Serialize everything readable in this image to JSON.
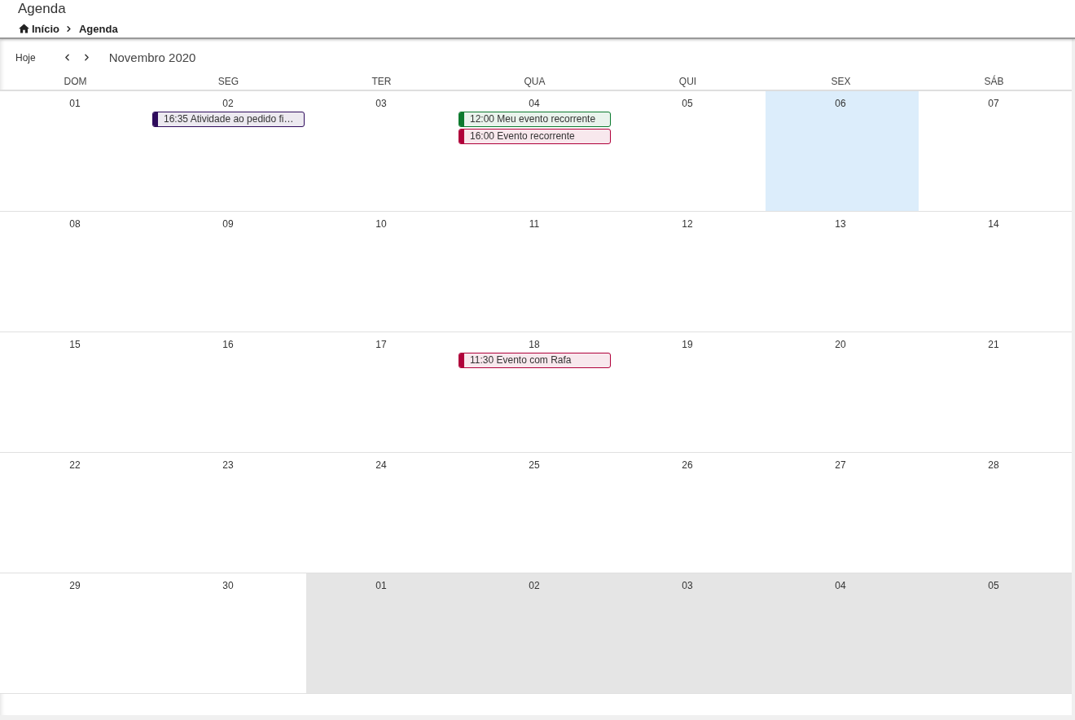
{
  "header": {
    "title": "Agenda",
    "breadcrumb": [
      {
        "label": "Início",
        "kind": "home"
      },
      {
        "label": "Agenda",
        "kind": "current"
      }
    ]
  },
  "toolbar": {
    "today_button": "Hoje",
    "month_title": "Novembro 2020"
  },
  "weekdays": [
    "DOM",
    "SEG",
    "TER",
    "QUA",
    "QUI",
    "SEX",
    "SÁB"
  ],
  "weeks": [
    [
      {
        "day": "01",
        "today": false,
        "outside_month": false
      },
      {
        "day": "02",
        "today": false,
        "outside_month": false,
        "events": [
          {
            "label": "16:35 Atividade ao pedido fi…",
            "color": "#2e0b5c"
          }
        ]
      },
      {
        "day": "03",
        "today": false,
        "outside_month": false
      },
      {
        "day": "04",
        "today": false,
        "outside_month": false,
        "events": [
          {
            "label": "12:00 Meu evento recorrente",
            "color": "#0b7a2e"
          },
          {
            "label": "16:00 Evento recorrente",
            "color": "#b0003a"
          }
        ]
      },
      {
        "day": "05",
        "today": false,
        "outside_month": false
      },
      {
        "day": "06",
        "today": true,
        "outside_month": false
      },
      {
        "day": "07",
        "today": false,
        "outside_month": false
      }
    ],
    [
      {
        "day": "08",
        "today": false,
        "outside_month": false
      },
      {
        "day": "09",
        "today": false,
        "outside_month": false
      },
      {
        "day": "10",
        "today": false,
        "outside_month": false
      },
      {
        "day": "11",
        "today": false,
        "outside_month": false
      },
      {
        "day": "12",
        "today": false,
        "outside_month": false
      },
      {
        "day": "13",
        "today": false,
        "outside_month": false
      },
      {
        "day": "14",
        "today": false,
        "outside_month": false
      }
    ],
    [
      {
        "day": "15",
        "today": false,
        "outside_month": false
      },
      {
        "day": "16",
        "today": false,
        "outside_month": false
      },
      {
        "day": "17",
        "today": false,
        "outside_month": false
      },
      {
        "day": "18",
        "today": false,
        "outside_month": false,
        "events": [
          {
            "label": "11:30 Evento com Rafa",
            "color": "#b0003a"
          }
        ]
      },
      {
        "day": "19",
        "today": false,
        "outside_month": false
      },
      {
        "day": "20",
        "today": false,
        "outside_month": false
      },
      {
        "day": "21",
        "today": false,
        "outside_month": false
      }
    ],
    [
      {
        "day": "22",
        "today": false,
        "outside_month": false
      },
      {
        "day": "23",
        "today": false,
        "outside_month": false
      },
      {
        "day": "24",
        "today": false,
        "outside_month": false
      },
      {
        "day": "25",
        "today": false,
        "outside_month": false
      },
      {
        "day": "26",
        "today": false,
        "outside_month": false
      },
      {
        "day": "27",
        "today": false,
        "outside_month": false
      },
      {
        "day": "28",
        "today": false,
        "outside_month": false
      }
    ],
    [
      {
        "day": "29",
        "today": false,
        "outside_month": false
      },
      {
        "day": "30",
        "today": false,
        "outside_month": false
      },
      {
        "day": "01",
        "today": false,
        "outside_month": true
      },
      {
        "day": "02",
        "today": false,
        "outside_month": true
      },
      {
        "day": "03",
        "today": false,
        "outside_month": true
      },
      {
        "day": "04",
        "today": false,
        "outside_month": true
      },
      {
        "day": "05",
        "today": false,
        "outside_month": true
      }
    ]
  ]
}
